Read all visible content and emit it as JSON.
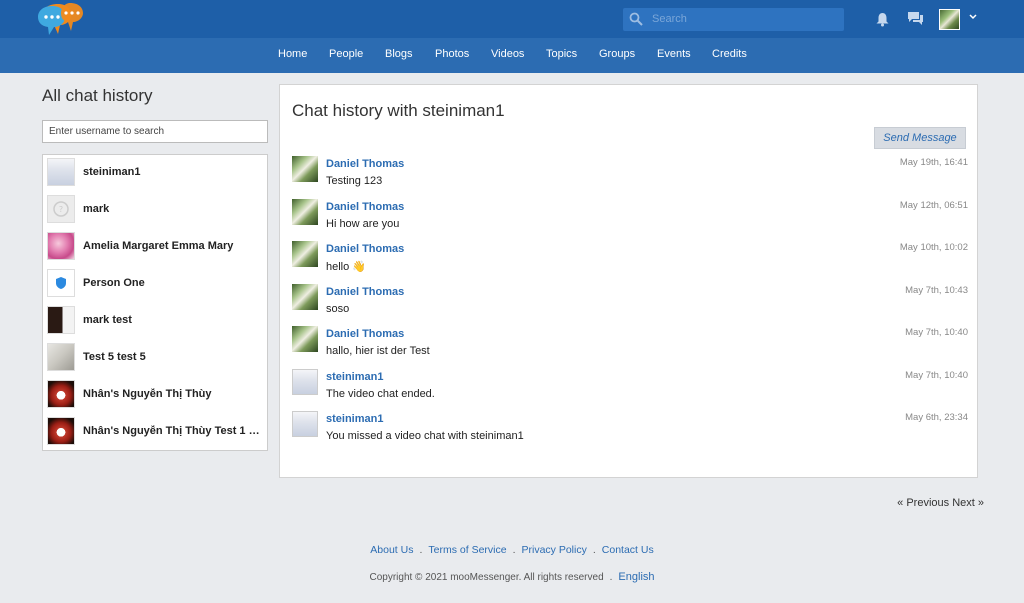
{
  "header": {
    "search_placeholder": "Search",
    "nav": [
      "Home",
      "People",
      "Blogs",
      "Photos",
      "Videos",
      "Topics",
      "Groups",
      "Events",
      "Credits"
    ]
  },
  "sidebar": {
    "title": "All chat history",
    "search_placeholder": "Enter username to search",
    "users": [
      {
        "name": "steiniman1",
        "avatar": "stein"
      },
      {
        "name": "mark",
        "avatar": "mark"
      },
      {
        "name": "Amelia Margaret Emma Mary",
        "avatar": "amelia"
      },
      {
        "name": "Person One",
        "avatar": "person"
      },
      {
        "name": "mark test",
        "avatar": "marktest"
      },
      {
        "name": "Test 5 test 5",
        "avatar": "test5"
      },
      {
        "name": "Nhân's Nguyễn Thị Thùy",
        "avatar": "nhan"
      },
      {
        "name": "Nhân's Nguyễn Thị Thùy Test 1 Te...",
        "avatar": "nhan"
      }
    ]
  },
  "main": {
    "title": "Chat history with steiniman1",
    "send_label": "Send Message",
    "messages": [
      {
        "sender": "Daniel Thomas",
        "text": "Testing 123",
        "time": "May 19th, 16:41",
        "avatar": "daniel"
      },
      {
        "sender": "Daniel Thomas",
        "text": "Hi how are you",
        "time": "May 12th, 06:51",
        "avatar": "daniel"
      },
      {
        "sender": "Daniel Thomas",
        "text": "hello 👋",
        "time": "May 10th, 10:02",
        "avatar": "daniel"
      },
      {
        "sender": "Daniel Thomas",
        "text": "soso",
        "time": "May 7th, 10:43",
        "avatar": "daniel"
      },
      {
        "sender": "Daniel Thomas",
        "text": "hallo, hier ist der Test",
        "time": "May 7th, 10:40",
        "avatar": "daniel"
      },
      {
        "sender": "steiniman1",
        "text": "The video chat ended.",
        "time": "May 7th, 10:40",
        "avatar": "stein"
      },
      {
        "sender": "steiniman1",
        "text": "You missed a video chat with steiniman1",
        "time": "May 6th, 23:34",
        "avatar": "stein"
      }
    ]
  },
  "pager": {
    "prev": "« Previous",
    "next": "Next »"
  },
  "footer": {
    "links": [
      "About Us",
      "Terms of Service",
      "Privacy Policy",
      "Contact Us"
    ],
    "copyright": "Copyright © 2021 mooMessenger. All rights reserved",
    "language": "English"
  },
  "colors": {
    "topbar": "#1e5fa8",
    "navbar": "#2c6cb2",
    "link": "#2c6cb2"
  }
}
